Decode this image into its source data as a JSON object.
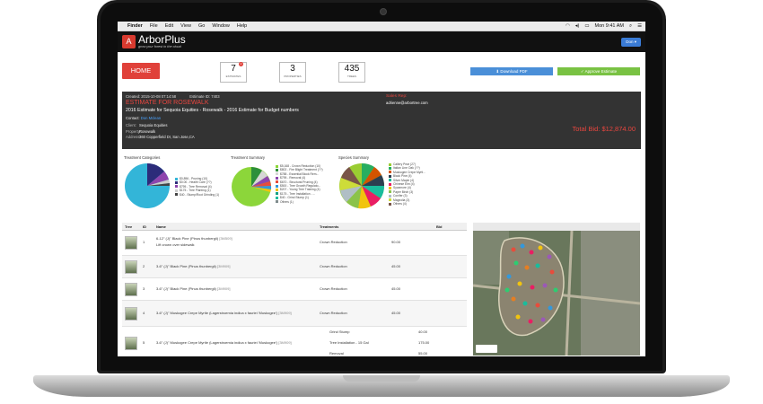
{
  "menubar": {
    "items": [
      "Finder",
      "File",
      "Edit",
      "View",
      "Go",
      "Window",
      "Help"
    ],
    "clock": "Mon 9:41 AM"
  },
  "app": {
    "logo_letter": "A",
    "name": "ArborPlus",
    "tagline": "grow your forest in the cloud",
    "user_button": "Don ▾"
  },
  "toolbar": {
    "home": "HOME",
    "stats": [
      {
        "value": "7",
        "label": "ESTIMATES",
        "badge": "2"
      },
      {
        "value": "3",
        "label": "PROPERTIES"
      },
      {
        "value": "435",
        "label": "TREES"
      }
    ],
    "download_pdf": "⬇ Download PDF",
    "approve": "✓ Approve Estimate"
  },
  "estimate": {
    "created": "Created: 2015-10-08 07:14:58",
    "estimate_id": "Estimate ID: 7403",
    "title": "ESTIMATE FOR ROSEWALK",
    "subtitle": "2016 Estimate for Sequoia Equities - Rosewalk - 2016 Estimate for Budget numbers",
    "contact_label": "Contact:",
    "contact_name": "Don Mclean",
    "client_label": "Client:",
    "client": "Sequoia Equities",
    "property_label": "Property:",
    "property": "Rosewalk",
    "address_label": "Address:",
    "address": "360 Copperfield Dr, San Jose,CA",
    "sales_rep": "Sales Rep:",
    "email": "adrienne@arbortree.com",
    "total": "Total Bid: $12,874.00"
  },
  "charts": {
    "categories": {
      "title": "Treatment Categories",
      "legend": [
        {
          "label": "$0,896 - Pruning (10)",
          "color": "#33b5d8"
        },
        {
          "label": "$0.00 - Health Care (??)",
          "color": "#2c2c7a"
        },
        {
          "label": "$795 - Tree Removal (4)",
          "color": "#8e44ad"
        },
        {
          "label": "$175 - Tree Planting (1)",
          "color": "#ccc"
        },
        {
          "label": "$40 - Stump/Root Grinding (1)",
          "color": "#444"
        }
      ]
    },
    "summary": {
      "title": "Treatment Summary",
      "legend": [
        {
          "label": "$5,168 - Crown Reduction (10)",
          "color": "#8cd63a"
        },
        {
          "label": "$802 - Fire Blight Treatment (??)",
          "color": "#2d8f3a"
        },
        {
          "label": "$788 - Essential Block Rem...",
          "color": "#d6d6d6"
        },
        {
          "label": "$795 - Removal (4)",
          "color": "#8e44ad"
        },
        {
          "label": "$670 - Structural Pruning (4)",
          "color": "#e74c3c"
        },
        {
          "label": "$500 - Tree Growth Regulato...",
          "color": "#3498db"
        },
        {
          "label": "$207 - Young Tree Training (4)",
          "color": "#f1c40f"
        },
        {
          "label": "$175 - Tree Installation - ...",
          "color": "#16a085"
        },
        {
          "label": "$40 - Grind Stump (1)",
          "color": "#1abc9c"
        },
        {
          "label": "Others (1)",
          "color": "#7f8c8d"
        }
      ]
    },
    "species": {
      "title": "Species Summary",
      "legend": [
        {
          "label": "Callery Pear (27)",
          "color": "#9acd32"
        },
        {
          "label": "Italian Line Oak (??)",
          "color": "#27ae60"
        },
        {
          "label": "Muskogee Crepe Myrtl...",
          "color": "#d35400"
        },
        {
          "label": "Black Pine (4)",
          "color": "#2c3e50"
        },
        {
          "label": "Silver Maple (4)",
          "color": "#1abc9c"
        },
        {
          "label": "Chinese Elm (4)",
          "color": "#e91e63"
        },
        {
          "label": "Sycamore (4)",
          "color": "#f1c40f"
        },
        {
          "label": "Paper Birch (3)",
          "color": "#8bc34a"
        },
        {
          "label": "Conifer (3)",
          "color": "#b0bec5"
        },
        {
          "label": "Magnolia (3)",
          "color": "#cddc39"
        },
        {
          "label": "Others (4)",
          "color": "#795548"
        }
      ]
    }
  },
  "table": {
    "headers": [
      "Tree",
      "ID",
      "Name",
      "Treatments",
      "Bid"
    ],
    "rows": [
      {
        "id": "1",
        "name": "6-12\" (J)\" Black Pine (Pinus thunbergii)",
        "code": "[3M509]",
        "note": "Lift crown over sidewalk",
        "treatments": [
          {
            "t": "Crown Reduction",
            "b": "90.00"
          }
        ]
      },
      {
        "id": "2",
        "name": "3-6\" (J)\" Black Pine (Pinus thunbergii)",
        "code": "[3M909]",
        "note": "",
        "treatments": [
          {
            "t": "Crown Reduction",
            "b": "45.00"
          }
        ]
      },
      {
        "id": "3",
        "name": "3-6\" (J)\" Black Pine (Pinus thunbergii)",
        "code": "[3M909]",
        "note": "",
        "treatments": [
          {
            "t": "Crown Reduction",
            "b": "45.00"
          }
        ]
      },
      {
        "id": "4",
        "name": "3-6\" (J)\" Muskogee Crepe Myrtle (Lagerstroemia indica x fauriei 'Muskogee')",
        "code": "[3M909]",
        "note": "",
        "treatments": [
          {
            "t": "Crown Reduction",
            "b": "45.00"
          }
        ]
      },
      {
        "id": "5",
        "name": "3-6\" (J)\" Muskogee Crepe Myrtle (Lagerstroemia indica x fauriei 'Muskogee')",
        "code": "[3M909]",
        "note": "",
        "treatments": [
          {
            "t": "Grind Stump",
            "b": "40.00"
          },
          {
            "t": "Tree Installation - 15 Gal",
            "b": "175.00"
          },
          {
            "t": "Removal",
            "b": "55.00"
          }
        ]
      }
    ]
  }
}
